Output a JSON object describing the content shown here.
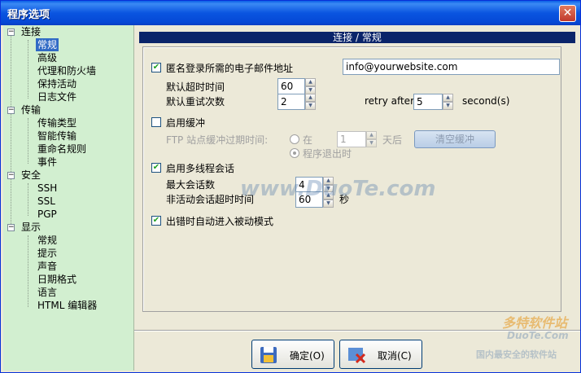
{
  "window": {
    "title": "程序选项"
  },
  "tree": {
    "groups": [
      {
        "label": "连接",
        "children": [
          "常规",
          "高级",
          "代理和防火墙",
          "保持活动",
          "日志文件"
        ]
      },
      {
        "label": "传输",
        "children": [
          "传输类型",
          "智能传输",
          "重命名规则",
          "事件"
        ]
      },
      {
        "label": "安全",
        "children": [
          "SSH",
          "SSL",
          "PGP"
        ]
      },
      {
        "label": "显示",
        "children": [
          "常规",
          "提示",
          "声音",
          "日期格式",
          "语言",
          "HTML 编辑器"
        ]
      }
    ],
    "selected": "常规"
  },
  "panel": {
    "header": "连接 / 常规",
    "anon_email": {
      "label": "匿名登录所需的电子邮件地址",
      "checked": true,
      "value": "info@yourwebsite.com"
    },
    "timeout": {
      "label": "默认超时时间",
      "value": "60"
    },
    "retry": {
      "label": "默认重试次数",
      "value": "2"
    },
    "retry_after": {
      "label": "retry after",
      "value": "5",
      "unit": "second(s)"
    },
    "cache": {
      "label": "启用缓冲",
      "checked": false,
      "expire_label": "FTP 站点缓冲过期时间:",
      "radio_in": "在",
      "days_value": "1",
      "days_unit": "天后",
      "radio_exit": "程序退出时",
      "clear_button": "清空缓冲"
    },
    "multithread": {
      "label": "启用多线程会话",
      "checked": true,
      "max_sessions_label": "最大会话数",
      "max_sessions_value": "4",
      "idle_timeout_label": "非活动会话超时时间",
      "idle_timeout_value": "60",
      "idle_unit": "秒"
    },
    "passive": {
      "label": "出错时自动进入被动模式",
      "checked": true
    }
  },
  "buttons": {
    "ok": "确定(O)",
    "cancel": "取消(C)"
  },
  "watermark": {
    "center": "www.DuoTe.com",
    "brand": "多特软件站",
    "brand_sub": "DuoTe.Com",
    "brand_tag": "国内最安全的软件站"
  },
  "icons": {
    "checkmark": "✔",
    "plus": "+",
    "minus": "−",
    "close": "✕",
    "ok_icon": "floppy-icon",
    "cancel_icon": "cancel-x-icon"
  }
}
